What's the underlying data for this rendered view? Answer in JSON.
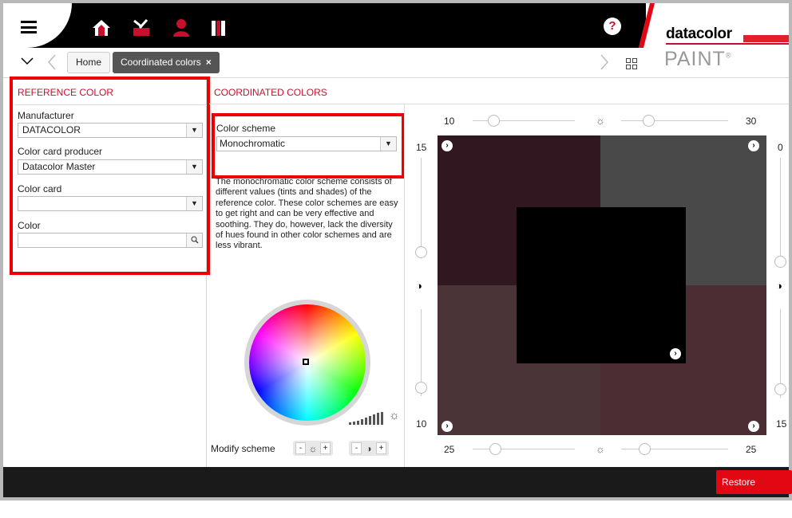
{
  "header": {
    "help_label": "?",
    "brand_name": "datacolor",
    "brand_product": "PAINT",
    "brand_mark": "®"
  },
  "nav": {
    "tab_home": "Home",
    "tab_active": "Coordinated colors",
    "tab_close": "×"
  },
  "reference": {
    "title": "REFERENCE COLOR",
    "manufacturer_label": "Manufacturer",
    "manufacturer_value": "DATACOLOR",
    "producer_label": "Color card producer",
    "producer_value": "Datacolor Master",
    "card_label": "Color card",
    "card_value": "",
    "color_label": "Color",
    "color_value": ""
  },
  "coordinated": {
    "title": "COORDINATED COLORS",
    "scheme_label": "Color scheme",
    "scheme_value": "Monochromatic",
    "description": "The monochromatic color scheme consists of different values (tints and shades) of the reference color. These color schemes are easy to get right and can be very effective and soothing. They do, however, lack the diversity of hues found in other color schemes and are less vibrant.",
    "modify_label": "Modify scheme",
    "minus": "-",
    "plus": "+"
  },
  "sliders": {
    "top_left": "10",
    "top_right": "30",
    "bottom_left": "25",
    "bottom_right": "25",
    "left_top": "15",
    "left_bottom": "10",
    "right_top": "0",
    "right_bottom": "15",
    "top_left_level": 0.2,
    "top_right_level": 0.25,
    "bottom_left_level": 0.22,
    "bottom_right_level": 0.22,
    "left_upper_level": 1.0,
    "left_lower_level": 0.9,
    "right_upper_level": 1.0,
    "right_lower_level": 0.9
  },
  "swatches": {
    "top_left_color": "#311820",
    "top_right_color": "#494949",
    "bottom_left_color": "#4a3438",
    "bottom_right_color": "#4b2d33",
    "center_color": "#000000"
  },
  "footer": {
    "restore_label": "Restore scheme"
  },
  "colors": {
    "accent": "#c8102e",
    "highlight": "#e00000"
  },
  "icons": [
    "hamburger-icon",
    "home-icon",
    "tools-icon",
    "user-icon",
    "books-icon",
    "chevron-down-icon",
    "back-icon",
    "forward-icon",
    "grid-icon",
    "search-icon",
    "sun-icon",
    "contrast-icon",
    "brightness-bars-icon",
    "arrow-right-icon"
  ]
}
